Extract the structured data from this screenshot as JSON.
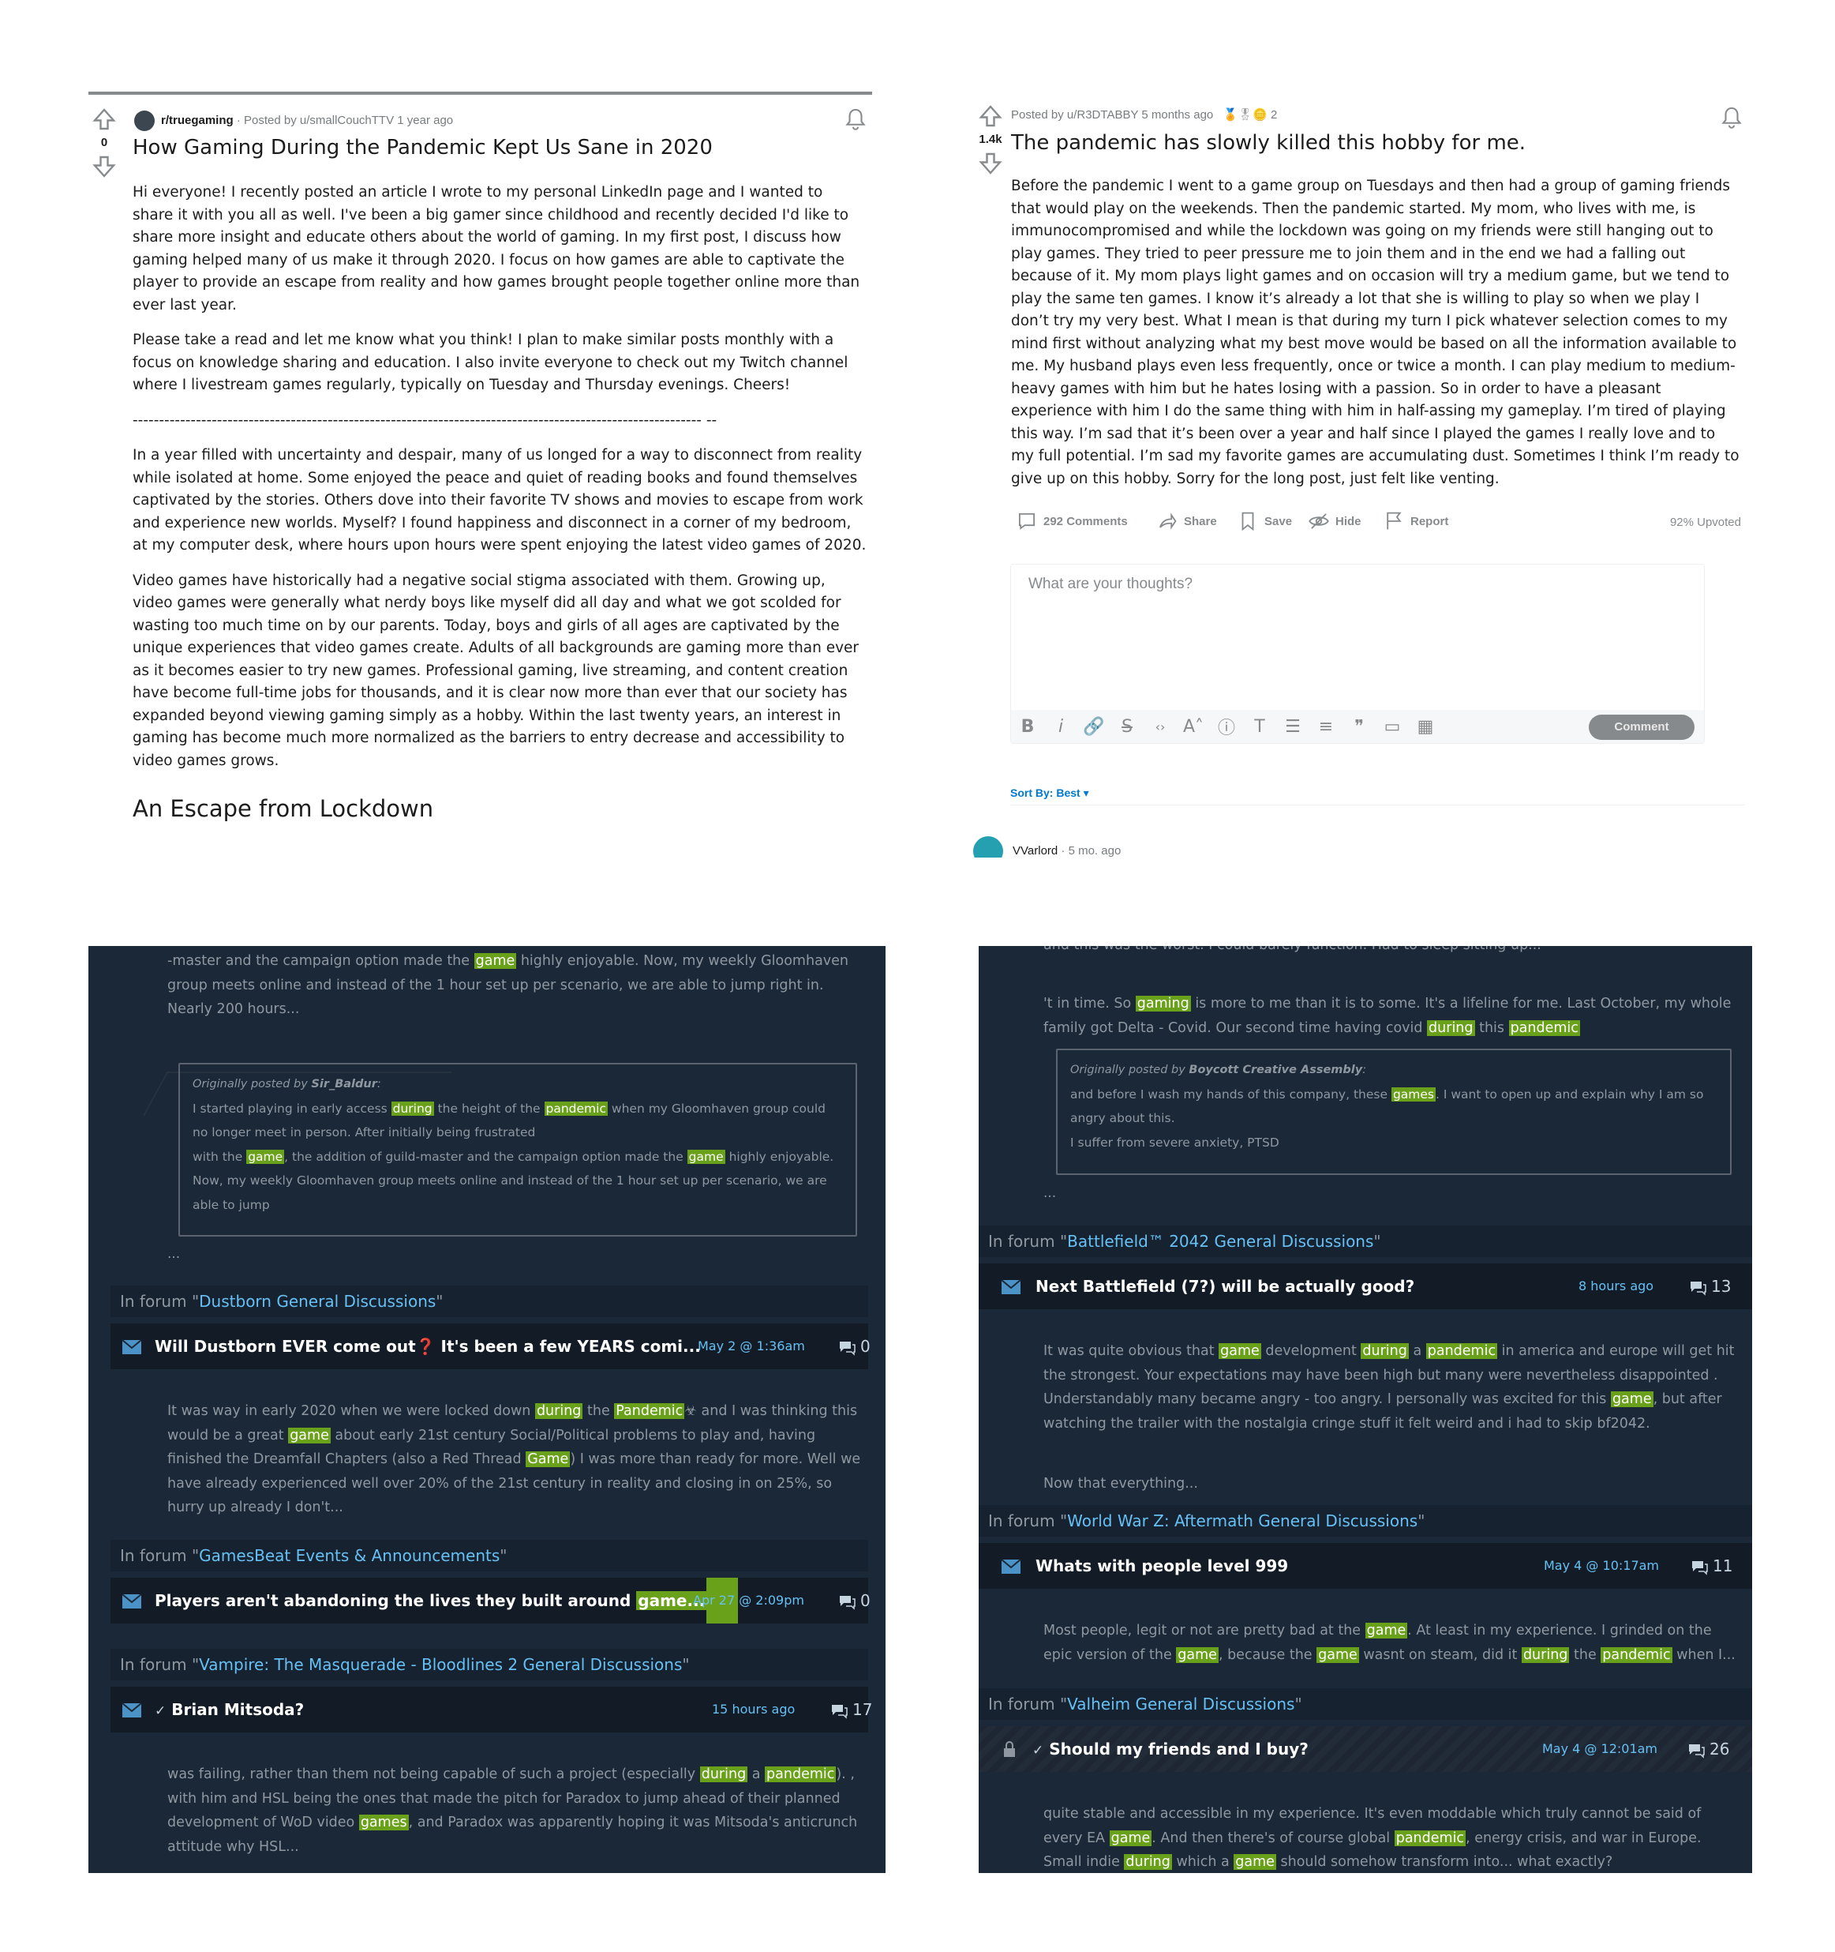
{
  "reddit_post_1": {
    "votes": "0",
    "subreddit": "r/truegaming",
    "posted_by": "· Posted by u/smallCouchTTV 1 year ago",
    "title": "How Gaming During the Pandemic Kept Us Sane in 2020",
    "paragraphs": [
      "Hi everyone! I recently posted an article I wrote to my personal LinkedIn page and I wanted to share it with you all as well. I've been a big gamer since childhood and recently decided I'd like to share more insight and educate others about the world of gaming. In my first post, I discuss how gaming helped many of us make it through 2020. I focus on how games are able to captivate the player to provide an escape from reality and how games brought people together online more than ever last year.",
      "Please take a read and let me know what you think! I plan to make similar posts monthly with a focus on knowledge sharing and education. I also invite everyone to check out my Twitch channel where I livestream games regularly, typically on Tuesday and Thursday evenings. Cheers!",
      "------------------------------------------------------------------------------------------------------------ --",
      "In a year filled with uncertainty and despair, many of us longed for a way to disconnect from reality while isolated at home. Some enjoyed the peace and quiet of reading books and found themselves captivated by the stories. Others dove into their favorite TV shows and movies to escape from work and experience new worlds. Myself? I found happiness and disconnect in a corner of my bedroom, at my computer desk, where hours upon hours were spent enjoying the latest video games of 2020.",
      "Video games have historically had a negative social stigma associated with them. Growing up, video games were generally what nerdy boys like myself did all day and what we got scolded for wasting too much time on by our parents. Today, boys and girls of all ages are captivated by the unique experiences that video games create. Adults of all backgrounds are gaming more than ever as it becomes easier to try new games. Professional gaming, live streaming, and content creation have become full-time jobs for thousands, and it is clear now more than ever that our society has expanded beyond viewing gaming simply as a hobby. Within the last twenty years, an interest in gaming has become much more normalized as the barriers to entry decrease and accessibility to video games grows."
    ],
    "subheading": "An Escape from Lockdown"
  },
  "reddit_post_2": {
    "votes": "1.4k",
    "posted_by": "Posted by u/R3DTABBY 5 months ago",
    "award_count": "2",
    "title": "The pandemic has slowly killed this hobby for me.",
    "body": "Before the pandemic I went to a game group on Tuesdays and then had a group of gaming friends that would play on the weekends. Then the pandemic started. My mom, who lives with me, is immunocompromised and while the lockdown was going on my friends were still hanging out to play games. They tried to peer pressure me to join them and in the end we had a falling out because of it. My mom plays light games and on occasion will try a medium game, but we tend to play the same ten games. I know it’s already a lot that she is willing to play so when we play I don’t try my very best. What I mean is that during my turn I pick whatever selection comes to my mind first without analyzing what my best move would be based on all the information available to me. My husband plays even less frequently, once or twice a month. I can play medium to medium-heavy games with him but he hates losing with a passion. So in order to have a pleasant experience with him I do the same thing with him in half-assing my gameplay. I’m tired of playing this way. I’m sad that it’s been over a year and half since I played the games I really love and to my full potential. I’m sad my favorite games are accumulating dust. Sometimes I think I’m ready to give up on this hobby. Sorry for the long post, just felt like venting.",
    "actions": {
      "comments": "292 Comments",
      "share": "Share",
      "save": "Save",
      "hide": "Hide",
      "report": "Report",
      "upvoted": "92% Upvoted"
    },
    "comment_placeholder": "What are your thoughts?",
    "comment_button": "Comment",
    "sort_by": "Sort By: Best",
    "first_commenter": "VVarlord",
    "first_comment_age": "· 5 mo. ago"
  },
  "steam_left": {
    "top_snippet": "-master and the campaign option made the [game] highly enjoyable. Now, my weekly Gloomhaven group meets online and instead of the 1 hour set up per scenario, we are able to jump right in. Nearly 200 hours...",
    "quote": {
      "prefix": "Originally posted by ",
      "author": "Sir_Baldur",
      "suffix": ":",
      "lines": [
        "I started playing in early access [during] the height of the [pandemic] when my Gloomhaven group could",
        "no longer meet in person. After initially being frustrated",
        "with the [game], the addition of guild-master and the campaign option made the [game] highly enjoyable.",
        "Now, my weekly Gloomhaven group meets online and instead of the 1 hour set up per scenario, we are",
        "able to jump"
      ]
    },
    "ellipsis": "...",
    "threads": [
      {
        "forum_prefix": "In forum \"",
        "forum": "Dustborn General Discussions",
        "forum_suffix": "\"",
        "title": "Will Dustborn EVER come out❓ It's been a few YEARS comi...",
        "date": "May 2 @ 1:36am",
        "count": "0",
        "snippet": "It was way in early 2020 when we were locked down [during] the [Pandemic]☣ and I was thinking this would be a great [game] about early 21st century Social/Political problems to play and, having finished the Dreamfall Chapters (also a Red Thread [Game]) I was more than ready for more. Well we have already experienced well over 20% of the 21st century in reality and closing in on 25%, so hurry up already I don't..."
      },
      {
        "forum_prefix": "In forum \"",
        "forum": "GamesBeat Events & Announcements",
        "forum_suffix": "\"",
        "title": "Players aren't abandoning the lives they built around ",
        "title_hl": "game...",
        "date": "Apr 27 @ 2:09pm",
        "count": "0"
      },
      {
        "forum_prefix": "In forum \"",
        "forum": "Vampire: The Masquerade - Bloodlines 2 General Discussions",
        "forum_suffix": "\"",
        "title": "Brian Mitsoda?",
        "date": "15 hours ago",
        "count": "17",
        "snippet": "was failing, rather than them not being capable of such a project (especially [during] a [pandemic]). , with him and HSL being the ones that made the pitch for Paradox to jump ahead of their planned development of WoD video [games], and Paradox was apparently hoping it was Mitsoda's anticrunch attitude why HSL..."
      }
    ]
  },
  "steam_right": {
    "top_cut": "and this was the worst. I could barely function. Had to sleep sitting up...",
    "top_snippet": "'t in time. So [gaming] is more to me than it is to some. It's a lifeline for me. Last October, my whole family got Delta - Covid. Our second time having covid [during] this [pandemic]",
    "quote": {
      "prefix": "Originally posted by ",
      "author": "Boycott Creative Assembly",
      "suffix": ":",
      "lines": [
        "and before I wash my hands of this company, these [games]. I want to open up and explain why I am so",
        "angry about this.",
        "I suffer from severe anxiety, PTSD"
      ]
    },
    "ellipsis": "...",
    "threads": [
      {
        "forum_prefix": "In forum \"",
        "forum": "Battlefield™ 2042 General Discussions",
        "forum_suffix": "\"",
        "title": "Next Battlefield (7?) will be actually good?",
        "date": "8 hours ago",
        "count": "13",
        "snippet": "It was quite obvious that [game] development [during] a [pandemic] in america and europe will get hit the strongest. Your expectations may have been high but many were nevertheless disappointed . Understandably many became angry - too angry. I personally was excited for this [game], but after watching the trailer with the nostalgia cringe stuff it felt weird and i had to skip bf2042.",
        "snippet_tail": "Now that everything..."
      },
      {
        "forum_prefix": "In forum \"",
        "forum": "World War Z: Aftermath General Discussions",
        "forum_suffix": "\"",
        "title": "Whats with people level 999",
        "date": "May 4 @ 10:17am",
        "count": "11",
        "snippet": "Most people, legit or not are pretty bad at the [game]. At least in my experience. I grinded on the epic version of the [game], because the [game] wasnt on steam, did it [during] the [pandemic] when I..."
      },
      {
        "forum_prefix": "In forum \"",
        "forum": "Valheim General Discussions",
        "forum_suffix": "\"",
        "title": "Should my friends and I buy?",
        "date": "May 4 @ 12:01am",
        "count": "26",
        "snippet": "quite stable and accessible in my experience. It's even moddable which truly cannot be said of every EA [game]. And then there's of course global [pandemic], energy crisis, and war in Europe. Small indie [during] which a [game] should somehow transform into... what exactly?"
      }
    ]
  },
  "colors": {
    "reddit_bg": "#ffffff",
    "reddit_link": "#0079d3",
    "steam_bg": "#1b2838",
    "steam_link": "#66c0f4",
    "highlight": "#6aa11a"
  }
}
